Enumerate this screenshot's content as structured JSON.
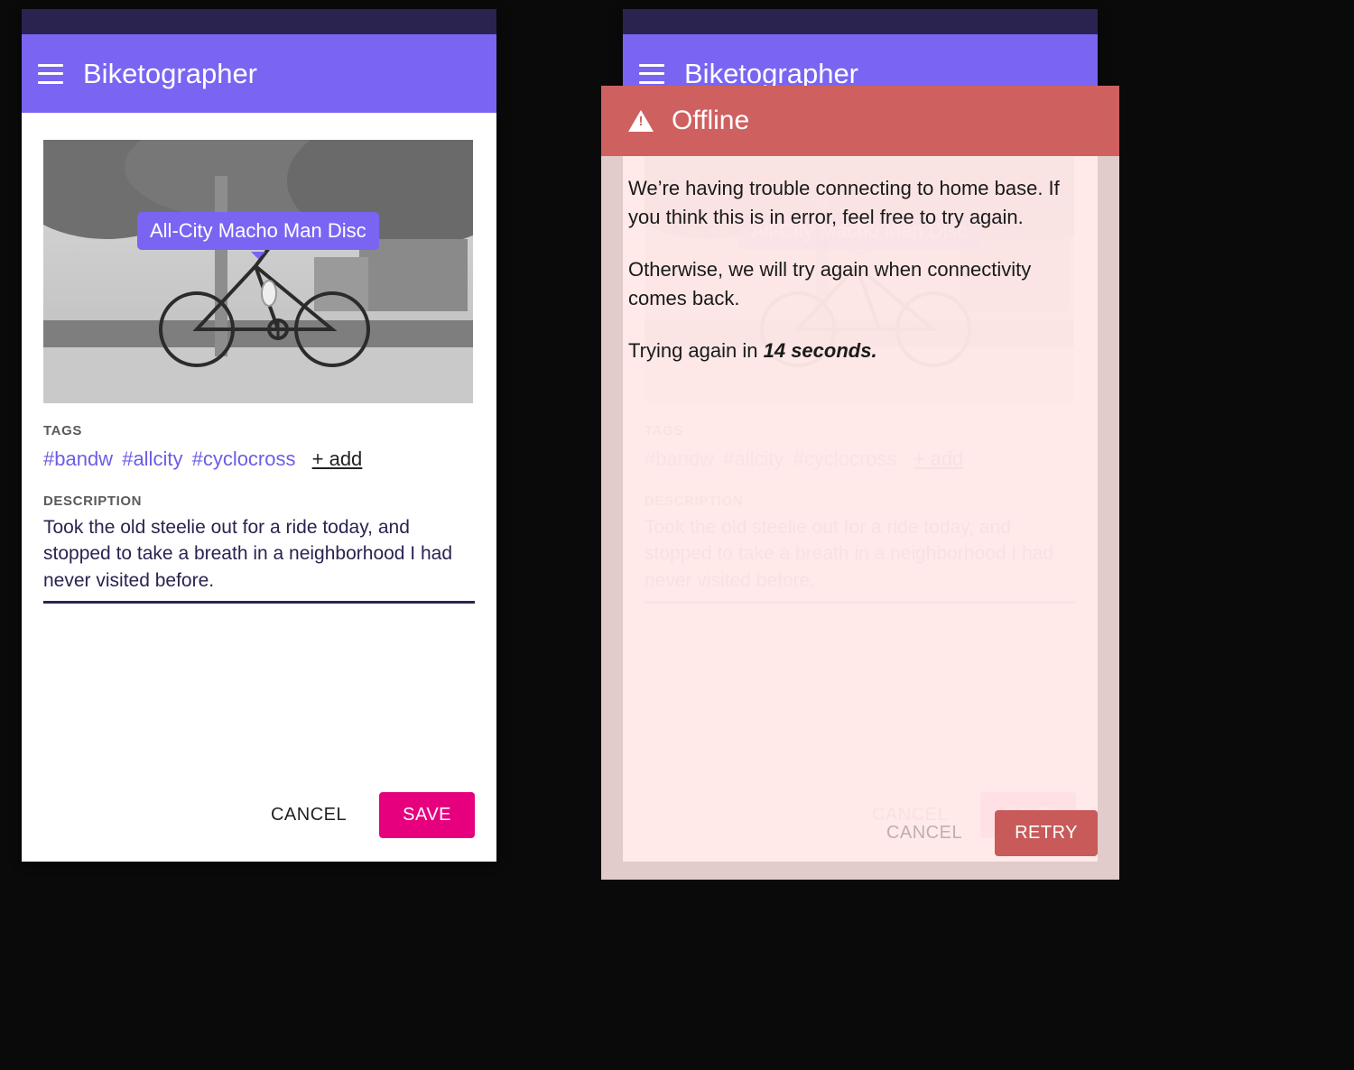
{
  "app": {
    "title": "Biketographer"
  },
  "photo": {
    "tooltip": "All-City Macho Man Disc"
  },
  "tags": {
    "label": "TAGS",
    "items": [
      "#bandw",
      "#allcity",
      "#cyclocross"
    ],
    "add": "+ add"
  },
  "description": {
    "label": "DESCRIPTION",
    "value": "Took the old steelie out for a ride today, and stopped to take a breath in a neighborhood I had never visited before."
  },
  "footer": {
    "cancel": "CANCEL",
    "save": "SAVE"
  },
  "offline": {
    "title": "Offline",
    "message1": "We’re having trouble connecting to home base.  If you think this is in error, feel free to try again.",
    "message2": "Otherwise, we will try again when connectivity comes back.",
    "retry_prefix": "Trying again in ",
    "retry_countdown": "14 seconds.",
    "cancel": "CANCEL",
    "retry": "RETRY"
  }
}
